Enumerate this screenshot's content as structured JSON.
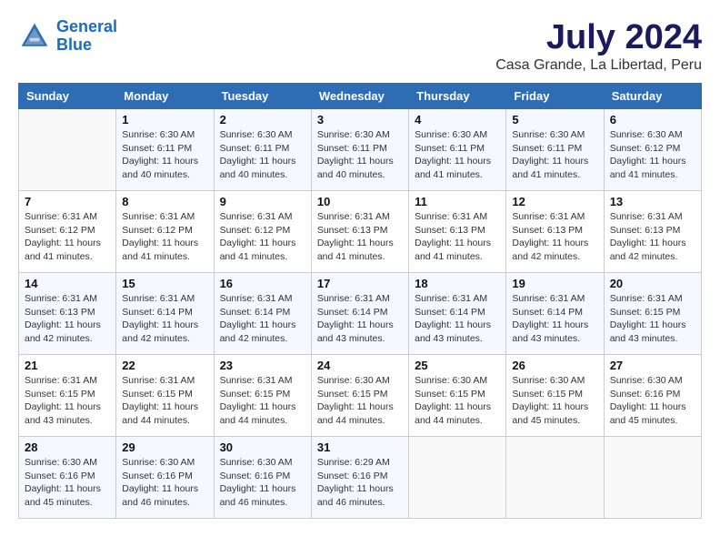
{
  "header": {
    "logo_line1": "General",
    "logo_line2": "Blue",
    "month": "July 2024",
    "location": "Casa Grande, La Libertad, Peru"
  },
  "weekdays": [
    "Sunday",
    "Monday",
    "Tuesday",
    "Wednesday",
    "Thursday",
    "Friday",
    "Saturday"
  ],
  "weeks": [
    [
      {
        "day": "",
        "sunrise": "",
        "sunset": "",
        "daylight": ""
      },
      {
        "day": "1",
        "sunrise": "Sunrise: 6:30 AM",
        "sunset": "Sunset: 6:11 PM",
        "daylight": "Daylight: 11 hours and 40 minutes."
      },
      {
        "day": "2",
        "sunrise": "Sunrise: 6:30 AM",
        "sunset": "Sunset: 6:11 PM",
        "daylight": "Daylight: 11 hours and 40 minutes."
      },
      {
        "day": "3",
        "sunrise": "Sunrise: 6:30 AM",
        "sunset": "Sunset: 6:11 PM",
        "daylight": "Daylight: 11 hours and 40 minutes."
      },
      {
        "day": "4",
        "sunrise": "Sunrise: 6:30 AM",
        "sunset": "Sunset: 6:11 PM",
        "daylight": "Daylight: 11 hours and 41 minutes."
      },
      {
        "day": "5",
        "sunrise": "Sunrise: 6:30 AM",
        "sunset": "Sunset: 6:11 PM",
        "daylight": "Daylight: 11 hours and 41 minutes."
      },
      {
        "day": "6",
        "sunrise": "Sunrise: 6:30 AM",
        "sunset": "Sunset: 6:12 PM",
        "daylight": "Daylight: 11 hours and 41 minutes."
      }
    ],
    [
      {
        "day": "7",
        "sunrise": "Sunrise: 6:31 AM",
        "sunset": "Sunset: 6:12 PM",
        "daylight": "Daylight: 11 hours and 41 minutes."
      },
      {
        "day": "8",
        "sunrise": "Sunrise: 6:31 AM",
        "sunset": "Sunset: 6:12 PM",
        "daylight": "Daylight: 11 hours and 41 minutes."
      },
      {
        "day": "9",
        "sunrise": "Sunrise: 6:31 AM",
        "sunset": "Sunset: 6:12 PM",
        "daylight": "Daylight: 11 hours and 41 minutes."
      },
      {
        "day": "10",
        "sunrise": "Sunrise: 6:31 AM",
        "sunset": "Sunset: 6:13 PM",
        "daylight": "Daylight: 11 hours and 41 minutes."
      },
      {
        "day": "11",
        "sunrise": "Sunrise: 6:31 AM",
        "sunset": "Sunset: 6:13 PM",
        "daylight": "Daylight: 11 hours and 41 minutes."
      },
      {
        "day": "12",
        "sunrise": "Sunrise: 6:31 AM",
        "sunset": "Sunset: 6:13 PM",
        "daylight": "Daylight: 11 hours and 42 minutes."
      },
      {
        "day": "13",
        "sunrise": "Sunrise: 6:31 AM",
        "sunset": "Sunset: 6:13 PM",
        "daylight": "Daylight: 11 hours and 42 minutes."
      }
    ],
    [
      {
        "day": "14",
        "sunrise": "Sunrise: 6:31 AM",
        "sunset": "Sunset: 6:13 PM",
        "daylight": "Daylight: 11 hours and 42 minutes."
      },
      {
        "day": "15",
        "sunrise": "Sunrise: 6:31 AM",
        "sunset": "Sunset: 6:14 PM",
        "daylight": "Daylight: 11 hours and 42 minutes."
      },
      {
        "day": "16",
        "sunrise": "Sunrise: 6:31 AM",
        "sunset": "Sunset: 6:14 PM",
        "daylight": "Daylight: 11 hours and 42 minutes."
      },
      {
        "day": "17",
        "sunrise": "Sunrise: 6:31 AM",
        "sunset": "Sunset: 6:14 PM",
        "daylight": "Daylight: 11 hours and 43 minutes."
      },
      {
        "day": "18",
        "sunrise": "Sunrise: 6:31 AM",
        "sunset": "Sunset: 6:14 PM",
        "daylight": "Daylight: 11 hours and 43 minutes."
      },
      {
        "day": "19",
        "sunrise": "Sunrise: 6:31 AM",
        "sunset": "Sunset: 6:14 PM",
        "daylight": "Daylight: 11 hours and 43 minutes."
      },
      {
        "day": "20",
        "sunrise": "Sunrise: 6:31 AM",
        "sunset": "Sunset: 6:15 PM",
        "daylight": "Daylight: 11 hours and 43 minutes."
      }
    ],
    [
      {
        "day": "21",
        "sunrise": "Sunrise: 6:31 AM",
        "sunset": "Sunset: 6:15 PM",
        "daylight": "Daylight: 11 hours and 43 minutes."
      },
      {
        "day": "22",
        "sunrise": "Sunrise: 6:31 AM",
        "sunset": "Sunset: 6:15 PM",
        "daylight": "Daylight: 11 hours and 44 minutes."
      },
      {
        "day": "23",
        "sunrise": "Sunrise: 6:31 AM",
        "sunset": "Sunset: 6:15 PM",
        "daylight": "Daylight: 11 hours and 44 minutes."
      },
      {
        "day": "24",
        "sunrise": "Sunrise: 6:30 AM",
        "sunset": "Sunset: 6:15 PM",
        "daylight": "Daylight: 11 hours and 44 minutes."
      },
      {
        "day": "25",
        "sunrise": "Sunrise: 6:30 AM",
        "sunset": "Sunset: 6:15 PM",
        "daylight": "Daylight: 11 hours and 44 minutes."
      },
      {
        "day": "26",
        "sunrise": "Sunrise: 6:30 AM",
        "sunset": "Sunset: 6:15 PM",
        "daylight": "Daylight: 11 hours and 45 minutes."
      },
      {
        "day": "27",
        "sunrise": "Sunrise: 6:30 AM",
        "sunset": "Sunset: 6:16 PM",
        "daylight": "Daylight: 11 hours and 45 minutes."
      }
    ],
    [
      {
        "day": "28",
        "sunrise": "Sunrise: 6:30 AM",
        "sunset": "Sunset: 6:16 PM",
        "daylight": "Daylight: 11 hours and 45 minutes."
      },
      {
        "day": "29",
        "sunrise": "Sunrise: 6:30 AM",
        "sunset": "Sunset: 6:16 PM",
        "daylight": "Daylight: 11 hours and 46 minutes."
      },
      {
        "day": "30",
        "sunrise": "Sunrise: 6:30 AM",
        "sunset": "Sunset: 6:16 PM",
        "daylight": "Daylight: 11 hours and 46 minutes."
      },
      {
        "day": "31",
        "sunrise": "Sunrise: 6:29 AM",
        "sunset": "Sunset: 6:16 PM",
        "daylight": "Daylight: 11 hours and 46 minutes."
      },
      {
        "day": "",
        "sunrise": "",
        "sunset": "",
        "daylight": ""
      },
      {
        "day": "",
        "sunrise": "",
        "sunset": "",
        "daylight": ""
      },
      {
        "day": "",
        "sunrise": "",
        "sunset": "",
        "daylight": ""
      }
    ]
  ]
}
